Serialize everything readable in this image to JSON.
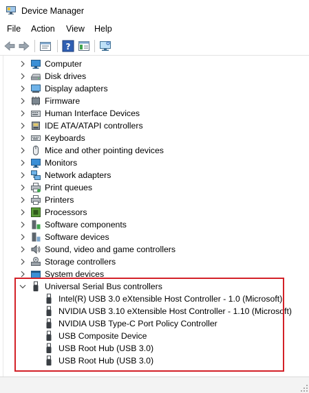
{
  "window": {
    "title": "Device Manager",
    "icon": "device-manager-icon"
  },
  "menu": [
    "File",
    "Action",
    "View",
    "Help"
  ],
  "toolbar": [
    {
      "name": "back-button",
      "icon": "arrow-left-icon"
    },
    {
      "name": "forward-button",
      "icon": "arrow-right-icon"
    },
    {
      "name": "properties-button",
      "icon": "properties-icon"
    },
    {
      "name": "help-button",
      "icon": "help-icon"
    },
    {
      "name": "show-hide-console-tree-button",
      "icon": "console-tree-icon"
    },
    {
      "name": "scan-hardware-button",
      "icon": "monitor-scan-icon"
    }
  ],
  "tree": {
    "categories": [
      {
        "label": "Computer",
        "icon": "computer-icon",
        "expanded": false
      },
      {
        "label": "Disk drives",
        "icon": "disk-drive-icon",
        "expanded": false
      },
      {
        "label": "Display adapters",
        "icon": "display-adapter-icon",
        "expanded": false
      },
      {
        "label": "Firmware",
        "icon": "firmware-icon",
        "expanded": false
      },
      {
        "label": "Human Interface Devices",
        "icon": "hid-icon",
        "expanded": false
      },
      {
        "label": "IDE ATA/ATAPI controllers",
        "icon": "ide-controller-icon",
        "expanded": false
      },
      {
        "label": "Keyboards",
        "icon": "keyboard-icon",
        "expanded": false
      },
      {
        "label": "Mice and other pointing devices",
        "icon": "mouse-icon",
        "expanded": false
      },
      {
        "label": "Monitors",
        "icon": "monitor-icon",
        "expanded": false
      },
      {
        "label": "Network adapters",
        "icon": "network-adapter-icon",
        "expanded": false
      },
      {
        "label": "Print queues",
        "icon": "print-queue-icon",
        "expanded": false
      },
      {
        "label": "Printers",
        "icon": "printer-icon",
        "expanded": false
      },
      {
        "label": "Processors",
        "icon": "processor-icon",
        "expanded": false
      },
      {
        "label": "Software components",
        "icon": "software-component-icon",
        "expanded": false
      },
      {
        "label": "Software devices",
        "icon": "software-device-icon",
        "expanded": false
      },
      {
        "label": "Sound, video and game controllers",
        "icon": "sound-icon",
        "expanded": false
      },
      {
        "label": "Storage controllers",
        "icon": "storage-controller-icon",
        "expanded": false
      },
      {
        "label": "System devices",
        "icon": "system-device-icon",
        "expanded": false
      },
      {
        "label": "Universal Serial Bus controllers",
        "icon": "usb-icon",
        "expanded": true
      }
    ],
    "usb_children": [
      "Intel(R) USB 3.0 eXtensible Host Controller - 1.0 (Microsoft)",
      "NVIDIA USB 3.10 eXtensible Host Controller - 1.10 (Microsoft)",
      "NVIDIA USB Type-C Port Policy Controller",
      "USB Composite Device",
      "USB Root Hub (USB 3.0)",
      "USB Root Hub (USB 3.0)"
    ]
  },
  "highlight_color": "#d32027"
}
